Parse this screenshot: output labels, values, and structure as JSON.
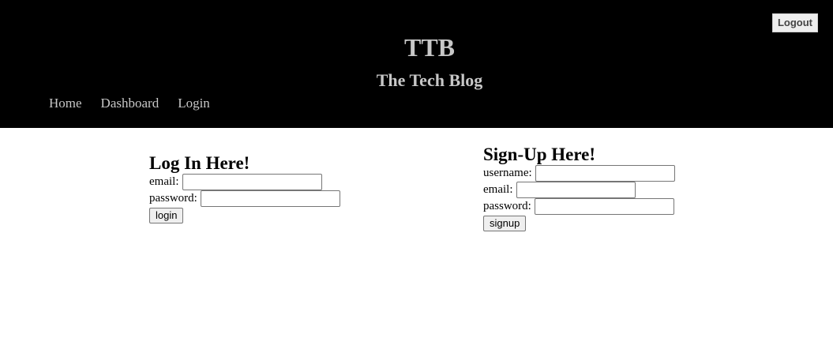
{
  "header": {
    "logout_label": "Logout",
    "title": "TTB",
    "subtitle": "The Tech Blog",
    "nav": [
      {
        "label": "Home"
      },
      {
        "label": "Dashboard"
      },
      {
        "label": "Login"
      }
    ]
  },
  "login": {
    "heading": "Log In Here!",
    "email_label": "email:",
    "email_value": "",
    "password_label": "password:",
    "password_value": "",
    "button_label": "login"
  },
  "signup": {
    "heading": "Sign-Up Here!",
    "username_label": "username:",
    "username_value": "",
    "email_label": "email:",
    "email_value": "",
    "password_label": "password:",
    "password_value": "",
    "button_label": "signup"
  }
}
